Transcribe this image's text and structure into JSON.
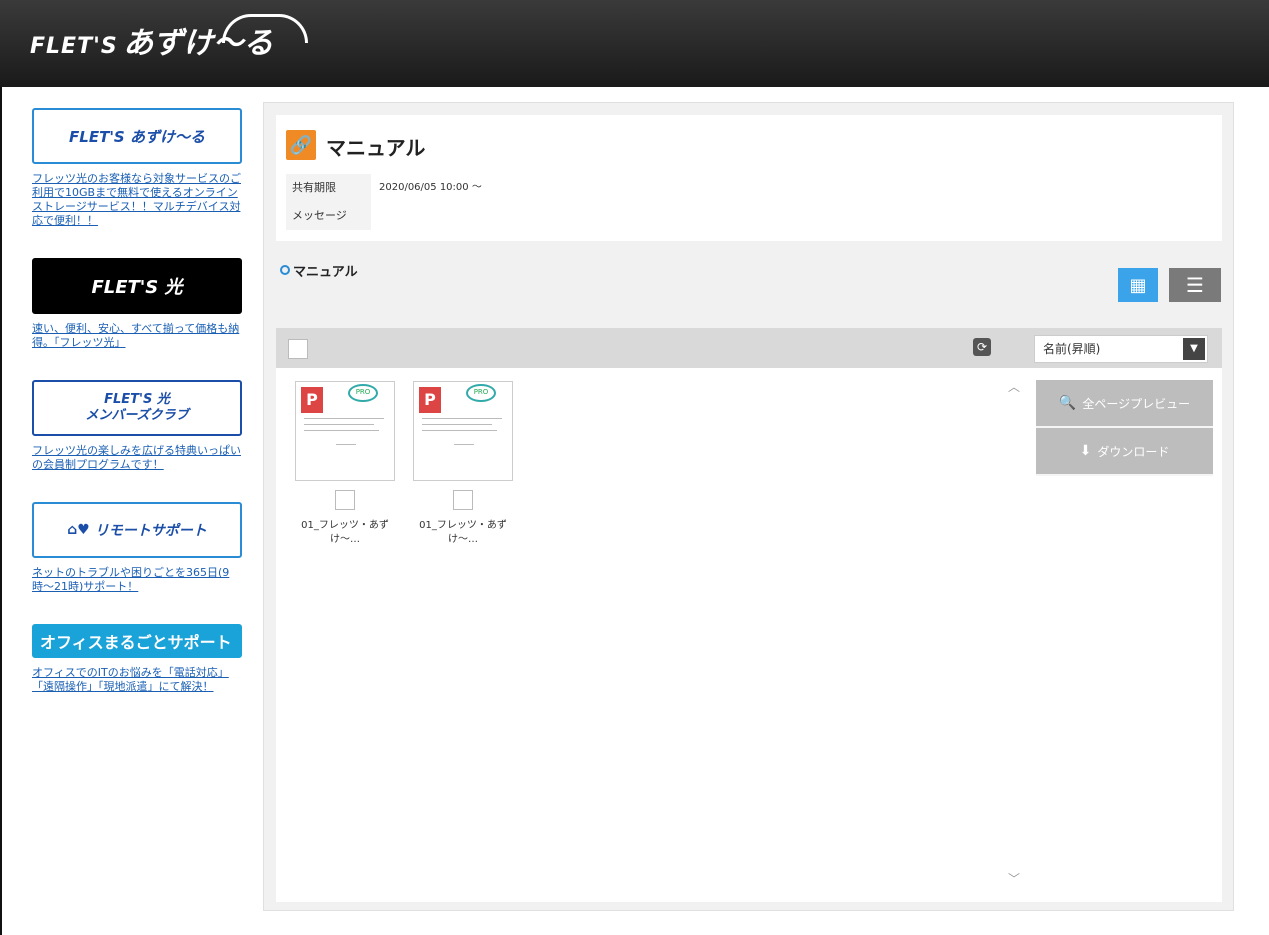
{
  "header": {
    "logo_en": "FLET'S",
    "logo_jp": "あずけ〜る"
  },
  "sidebar": {
    "banners": [
      {
        "label": "FLET'S あずけ〜る",
        "text": "フレッツ光のお客様なら対象サービスのご利用で10GBまで無料で使えるオンラインストレージサービス！！マルチデバイス対応で便利！！"
      },
      {
        "label": "FLET'S 光",
        "text": "速い、便利、安心、すべて揃って価格も納得。「フレッツ光」"
      },
      {
        "label_line1": "FLET'S 光",
        "label_line2": "メンバーズクラブ",
        "text": "フレッツ光の楽しみを広げる特典いっぱいの会員制プログラムです！"
      },
      {
        "label": "リモートサポート",
        "text": "ネットのトラブルや困りごとを365日(9時〜21時)サポート！"
      },
      {
        "label": "オフィスまるごとサポート",
        "text": "オフィスでのITのお悩みを「電話対応」「遠隔操作」「現地派遣」にて解決！"
      }
    ]
  },
  "share": {
    "title": "マニュアル",
    "period_label": "共有期限",
    "period_value": "2020/06/05 10:00 〜",
    "message_label": "メッセージ",
    "message_value": ""
  },
  "folder": {
    "label": "マニュアル"
  },
  "view": {
    "grid_icon": "▦",
    "list_icon": "☰",
    "active": "grid"
  },
  "toolbar": {
    "sort_value": "名前(昇順)",
    "sort_arrow": "▼",
    "refresh_icon": "⟳"
  },
  "files": [
    {
      "name_line1": "01_フレッツ・あず",
      "name_line2": "け〜…",
      "type_letter": "P",
      "badge": "PRO"
    },
    {
      "name_line1": "01_フレッツ・あず",
      "name_line2": "け〜…",
      "type_letter": "P",
      "badge": "PRO"
    }
  ],
  "actions": {
    "preview_label": "全ページプレビュー",
    "download_label": "ダウンロード",
    "preview_icon": "🔍",
    "download_icon": "⬇"
  },
  "colors": {
    "accent": "#3aa3ea",
    "header_bg": "#2a2a2a",
    "share_icon": "#f08a24"
  }
}
